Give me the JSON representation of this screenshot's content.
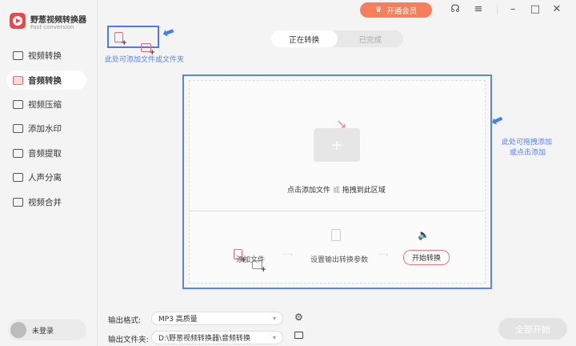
{
  "app": {
    "title": "野葱视频转换器",
    "subtitle": "Fast conversion"
  },
  "sidebar": {
    "items": [
      {
        "label": "视频转换"
      },
      {
        "label": "音频转换"
      },
      {
        "label": "视频压缩"
      },
      {
        "label": "添加水印"
      },
      {
        "label": "音频提取"
      },
      {
        "label": "人声分离"
      },
      {
        "label": "视频合并"
      }
    ],
    "active_index": 1,
    "user": "未登录"
  },
  "header": {
    "vip_label": "开通会员"
  },
  "tabs": [
    {
      "label": "正在转换"
    },
    {
      "label": "已完成"
    }
  ],
  "hints": {
    "add": "此处可添加文件或文件夹",
    "drag_line1": "此处可拖拽添加",
    "drag_line2": "或点击添加"
  },
  "drop": {
    "text": "点击添加文件",
    "or": "或",
    "text2": "拖拽到此区域"
  },
  "steps": {
    "s1": "添加文件",
    "s2": "设置输出转换参数",
    "s3": "开始转换"
  },
  "output": {
    "format_label": "输出格式:",
    "format_value": "MP3 高质量",
    "folder_label": "输出文件夹:",
    "folder_value": "D:\\野葱视频转换器\\音频转换"
  },
  "start_all": "全部开始",
  "colors": {
    "accent": "#f57f5b",
    "highlight": "#4a7af0"
  }
}
